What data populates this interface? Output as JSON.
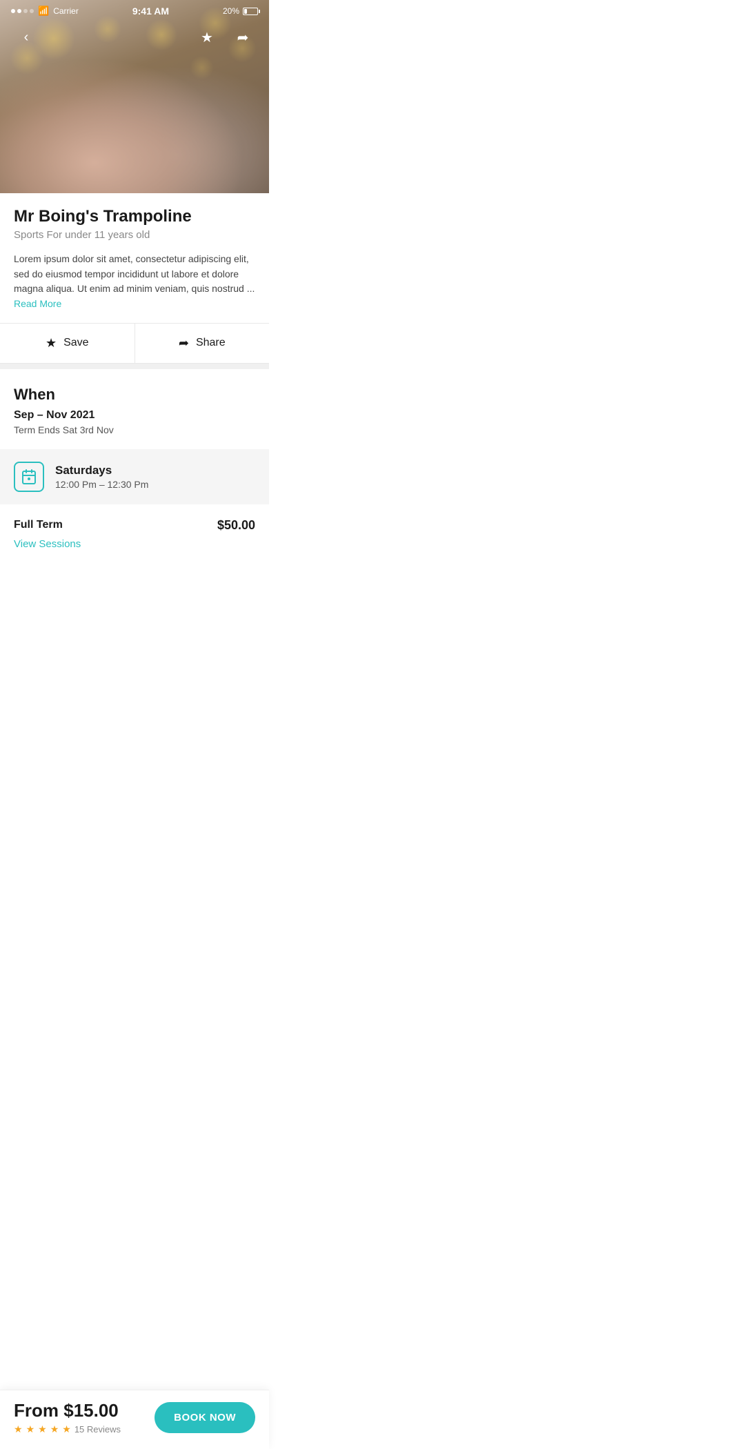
{
  "statusBar": {
    "carrier": "Carrier",
    "time": "9:41 AM",
    "battery": "20%"
  },
  "nav": {
    "backLabel": "‹",
    "saveLabel": "★",
    "shareLabel": "⎋"
  },
  "hero": {
    "altText": "Two young girls sitting on a bed with fairy lights"
  },
  "detail": {
    "title": "Mr Boing's Trampoline",
    "subtitle": "Sports For under 11 years old",
    "description": "Lorem ipsum dolor sit amet, consectetur adipiscing elit, sed do eiusmod tempor incididunt ut labore et dolore magna aliqua. Ut enim ad minim veniam, quis nostrud ...",
    "readMoreLabel": "Read More"
  },
  "actions": {
    "saveLabel": "Save",
    "shareLabel": "Share"
  },
  "when": {
    "heading": "When",
    "dateRange": "Sep – Nov 2021",
    "termEnds": "Term Ends Sat 3rd Nov"
  },
  "session": {
    "day": "Saturdays",
    "time": "12:00 Pm – 12:30 Pm"
  },
  "pricing": {
    "label": "Full Term",
    "amount": "$50.00",
    "viewSessionsLabel": "View Sessions"
  },
  "footer": {
    "fromLabel": "From $",
    "price": "15.00",
    "starCount": 5,
    "reviewCount": "15 Reviews",
    "bookNowLabel": "BOOK NOW"
  },
  "colors": {
    "accent": "#2abfbf",
    "star": "#f5a623",
    "dark": "#1a1a1a",
    "mid": "#555",
    "light": "#888"
  }
}
